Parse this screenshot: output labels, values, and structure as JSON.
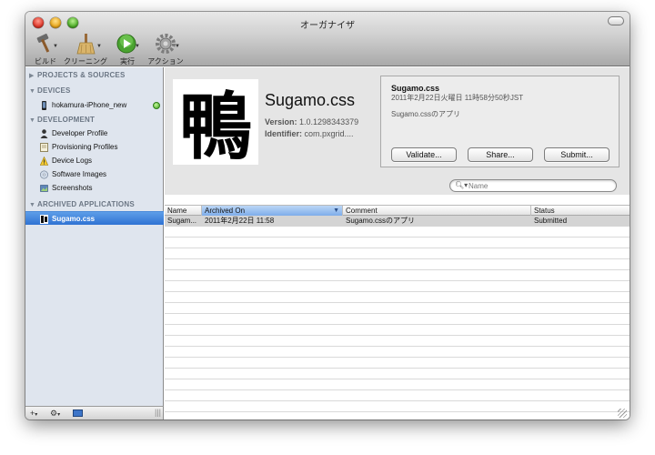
{
  "window": {
    "title": "オーガナイザ"
  },
  "toolbar": {
    "build_label": "ビルド",
    "clean_label": "クリーニング",
    "run_label": "実行",
    "action_label": "アクション"
  },
  "sidebar": {
    "sections": {
      "projects": "PROJECTS & SOURCES",
      "devices": "DEVICES",
      "development": "DEVELOPMENT",
      "archived": "ARCHIVED APPLICATIONS"
    },
    "devices": [
      {
        "label": "hokamura-iPhone_new"
      }
    ],
    "development": [
      {
        "label": "Developer Profile"
      },
      {
        "label": "Provisioning Profiles"
      },
      {
        "label": "Device Logs"
      },
      {
        "label": "Software Images"
      },
      {
        "label": "Screenshots"
      }
    ],
    "archived": [
      {
        "label": "Sugamo.css"
      }
    ],
    "footer": {
      "add": "+",
      "action": "⚙"
    }
  },
  "app": {
    "name": "Sugamo.css",
    "version_label": "Version:",
    "version": "1.0.1298343379",
    "identifier_label": "Identifier:",
    "identifier": "com.pxgrid....",
    "icon_glyph": "鴨"
  },
  "detail": {
    "title": "Sugamo.css",
    "date": "2011年2月22日火曜日 11時58分50秒JST",
    "comment": "Sugamo.cssのアプリ",
    "validate": "Validate...",
    "share": "Share...",
    "submit": "Submit..."
  },
  "search": {
    "placeholder": "Name"
  },
  "table": {
    "headers": {
      "name": "Name",
      "archived_on": "Archived On",
      "comment": "Comment",
      "status": "Status"
    },
    "rows": [
      {
        "name": "Sugam...",
        "archived_on": "2011年2月22日 11:58",
        "comment": "Sugamo.cssのアプリ",
        "status": "Submitted"
      }
    ]
  }
}
